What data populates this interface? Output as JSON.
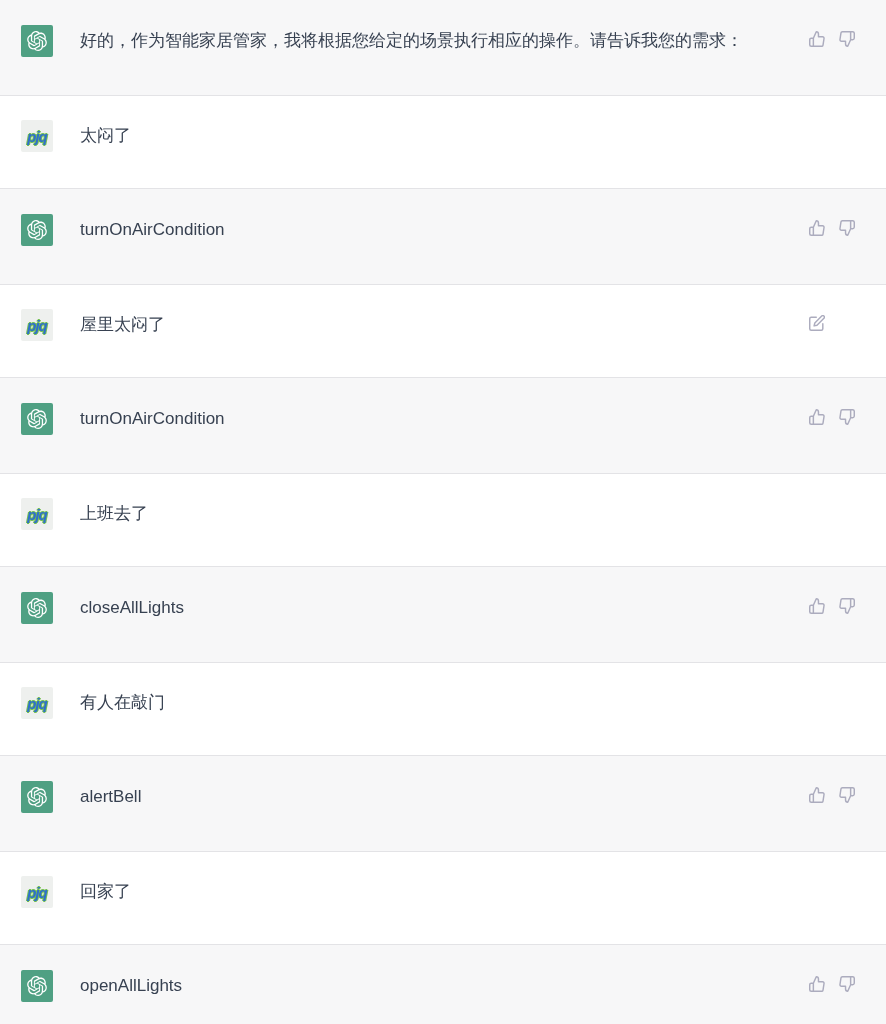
{
  "messages": [
    {
      "kind": "assistant",
      "text": "好的，作为智能家居管家，我将根据您给定的场景执行相应的操作。请告诉我您的需求："
    },
    {
      "kind": "user",
      "avatar_text": "pjq",
      "text": "太闷了",
      "edit_icon": false
    },
    {
      "kind": "assistant",
      "text": "turnOnAirCondition"
    },
    {
      "kind": "user",
      "avatar_text": "pjq",
      "text": "屋里太闷了",
      "edit_icon": true
    },
    {
      "kind": "assistant",
      "text": "turnOnAirCondition"
    },
    {
      "kind": "user",
      "avatar_text": "pjq",
      "text": "上班去了",
      "edit_icon": false
    },
    {
      "kind": "assistant",
      "text": "closeAllLights"
    },
    {
      "kind": "user",
      "avatar_text": "pjq",
      "text": "有人在敲门",
      "edit_icon": false
    },
    {
      "kind": "assistant",
      "text": "alertBell"
    },
    {
      "kind": "user",
      "avatar_text": "pjq",
      "text": "回家了",
      "edit_icon": false
    },
    {
      "kind": "assistant",
      "text": "openAllLights"
    }
  ]
}
